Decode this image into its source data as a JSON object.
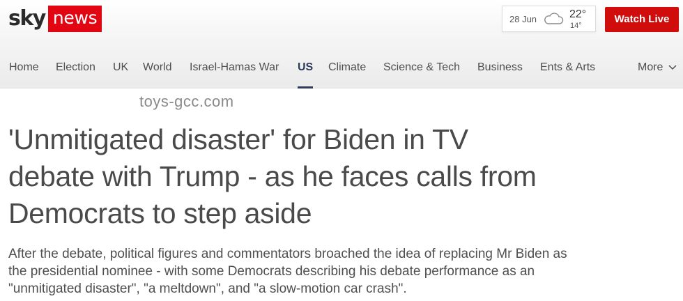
{
  "logo": {
    "sky": "sky",
    "news": "news",
    "brand_red": "#e20613"
  },
  "weather": {
    "date": "28 Jun",
    "icon": "cloud-icon",
    "high": "22°",
    "low": "14°"
  },
  "watch_live": {
    "label": "Watch Live",
    "color": "#d00c0c"
  },
  "nav": {
    "items": [
      "Home",
      "Election",
      "UK",
      "World",
      "Israel-Hamas War",
      "US",
      "Climate",
      "Science & Tech",
      "Business",
      "Ents & Arts"
    ],
    "active": "US",
    "more_label": "More",
    "active_color": "#2d3a5b"
  },
  "watermark": "toys-gcc.com",
  "article": {
    "headline": "'Unmitigated disaster' for Biden in TV debate with Trump - as he faces calls from Democrats to step aside",
    "standfirst": "After the debate, political figures and commentators broached the idea of replacing Mr Biden as the presidential nominee - with some Democrats describing his debate performance as an \"unmitigated disaster\", \"a meltdown\", and \"a slow-motion car crash\"."
  }
}
